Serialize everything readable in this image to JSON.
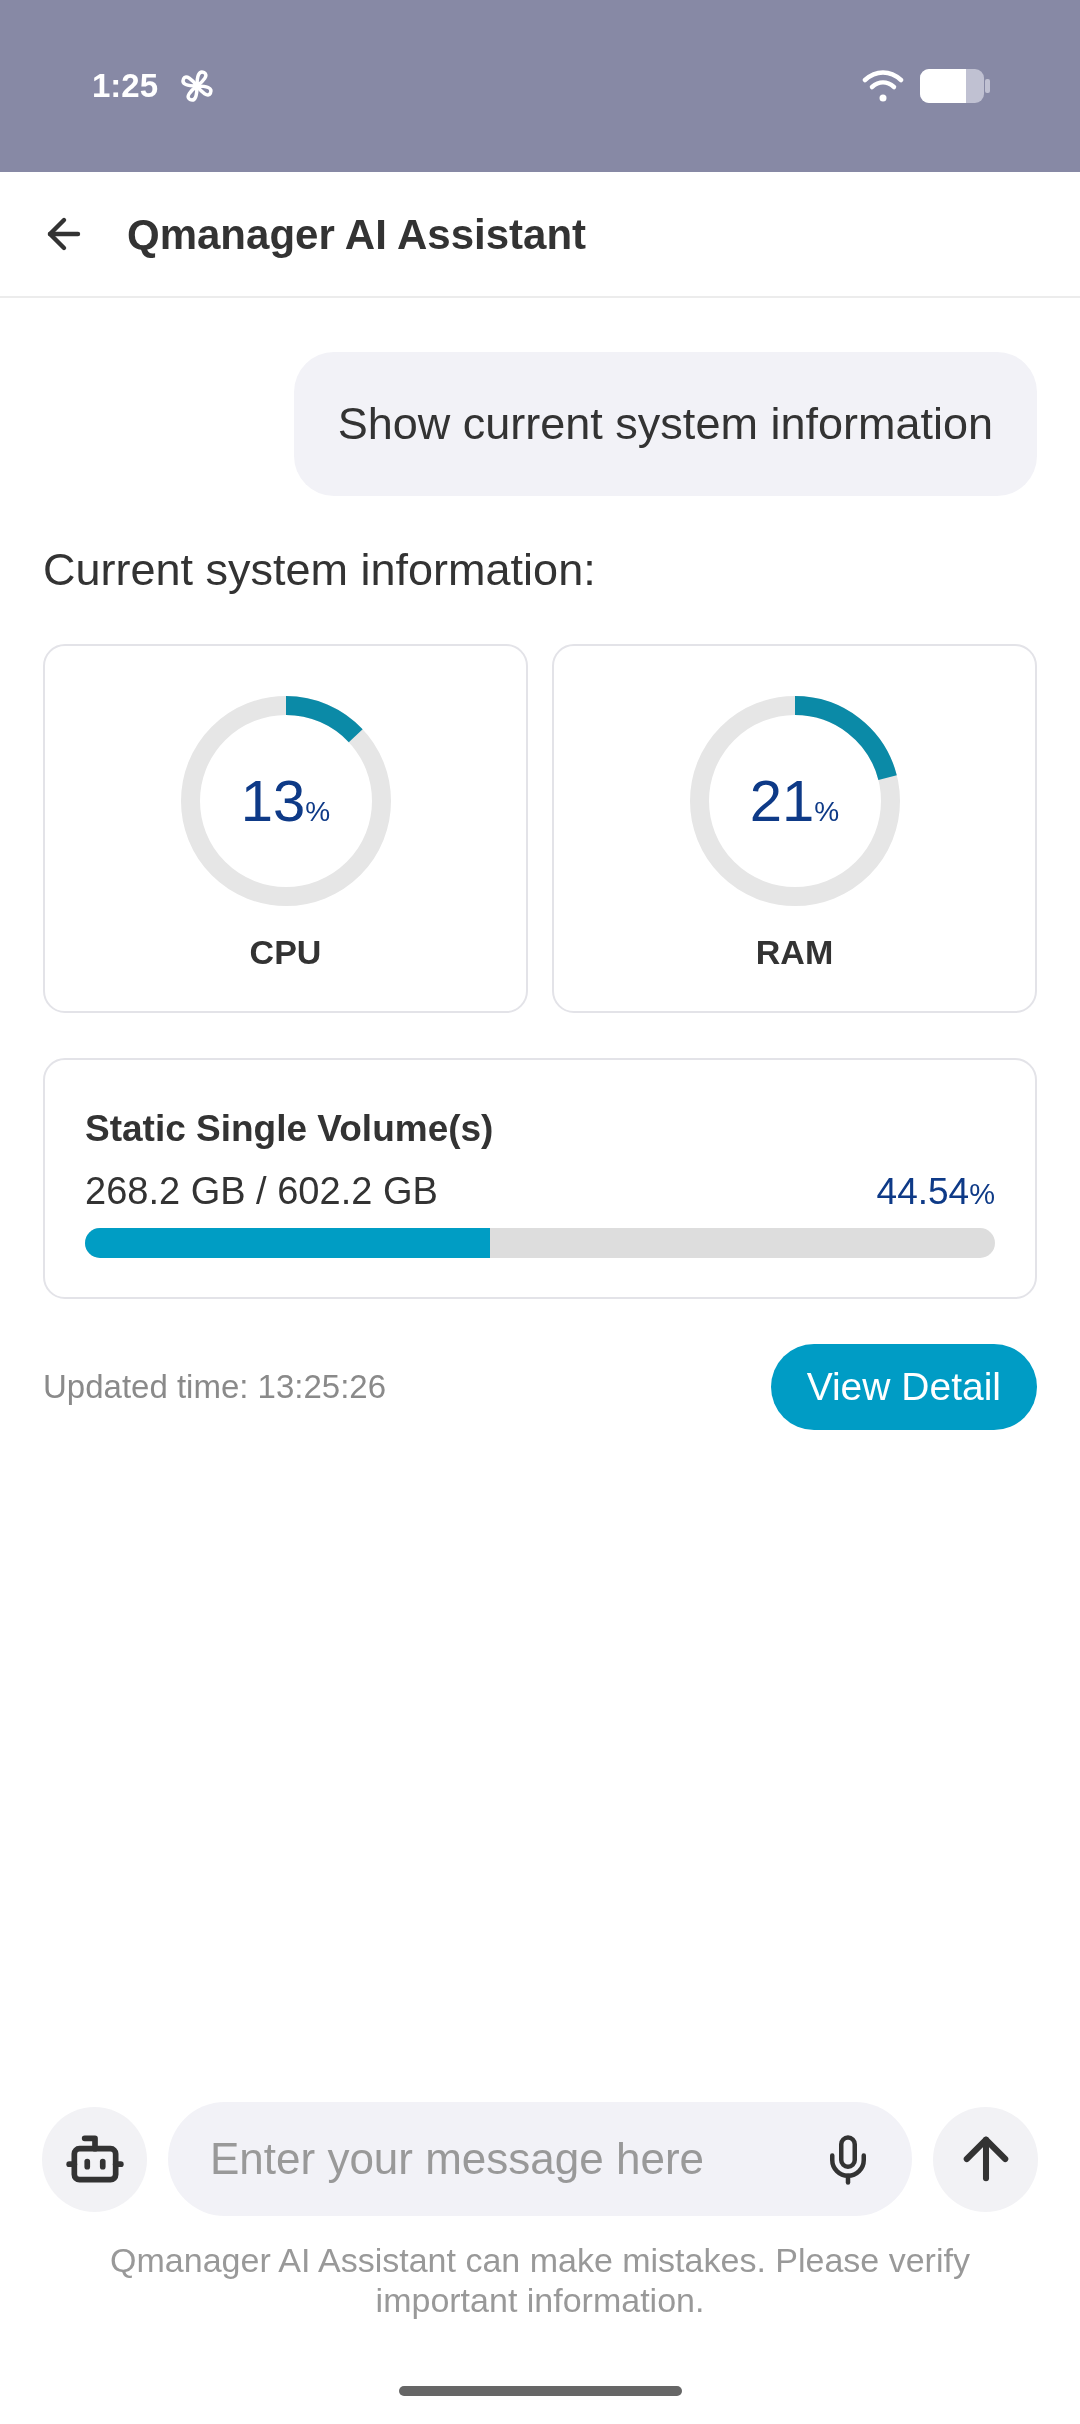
{
  "status_bar": {
    "time": "1:25"
  },
  "header": {
    "title": "Qmanager AI Assistant"
  },
  "chat": [
    {
      "kind": "user",
      "text": "Show current system information"
    },
    {
      "kind": "assistant",
      "intro": "Current system information:",
      "gauges": [
        {
          "label": "CPU",
          "value": "13",
          "unit": "%",
          "level": 0.13
        },
        {
          "label": "RAM",
          "value": "21",
          "unit": "%",
          "level": 0.21
        }
      ],
      "volume": {
        "title": "Static Single Volume(s)",
        "usage": "268.2 GB / 602.2 GB",
        "percent": "44.54",
        "unit": "%",
        "level": 0.4454
      },
      "updated": "Updated time: 13:25:26",
      "button": "View Detail"
    }
  ],
  "composer": {
    "placeholder": "Enter your message here"
  },
  "disclaimer": "Qmanager AI Assistant can make mistakes. Please verify important information."
}
